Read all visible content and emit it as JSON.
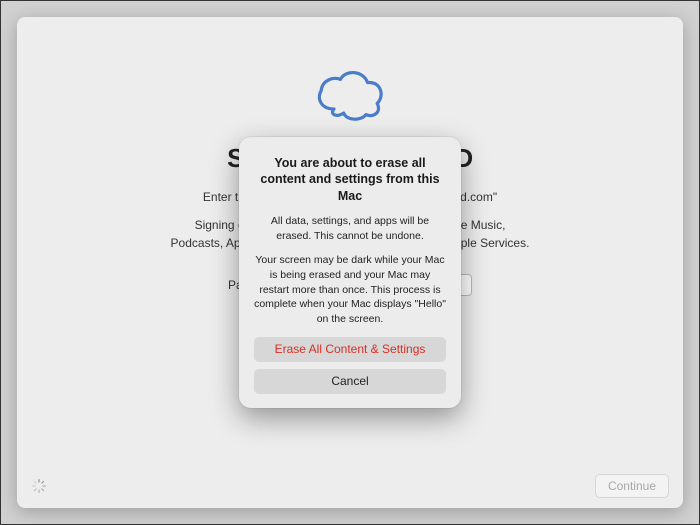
{
  "background": {
    "title": "Sign Out of Apple ID",
    "subtitle": "Enter the password for the Apple ID \"user@icloud.com\"",
    "signout_line1": "Signing out will remove any Apple Pay cards, Apple Music,",
    "signout_line2": "Podcasts, Apple Books audiobooks associated with Apple Services.",
    "password_label": "Password:",
    "continue_label": "Continue"
  },
  "modal": {
    "title": "You are about to erase all content and settings from this Mac",
    "body1": "All data, settings, and apps will be erased. This cannot be undone.",
    "body2": "Your screen may be dark while your Mac is being erased and your Mac may restart more than once. This process is complete when your Mac displays \"Hello\" on the screen.",
    "erase_label": "Erase All Content & Settings",
    "cancel_label": "Cancel"
  },
  "colors": {
    "destructive": "#d93025",
    "cloud_stroke": "#4a7cc9"
  }
}
